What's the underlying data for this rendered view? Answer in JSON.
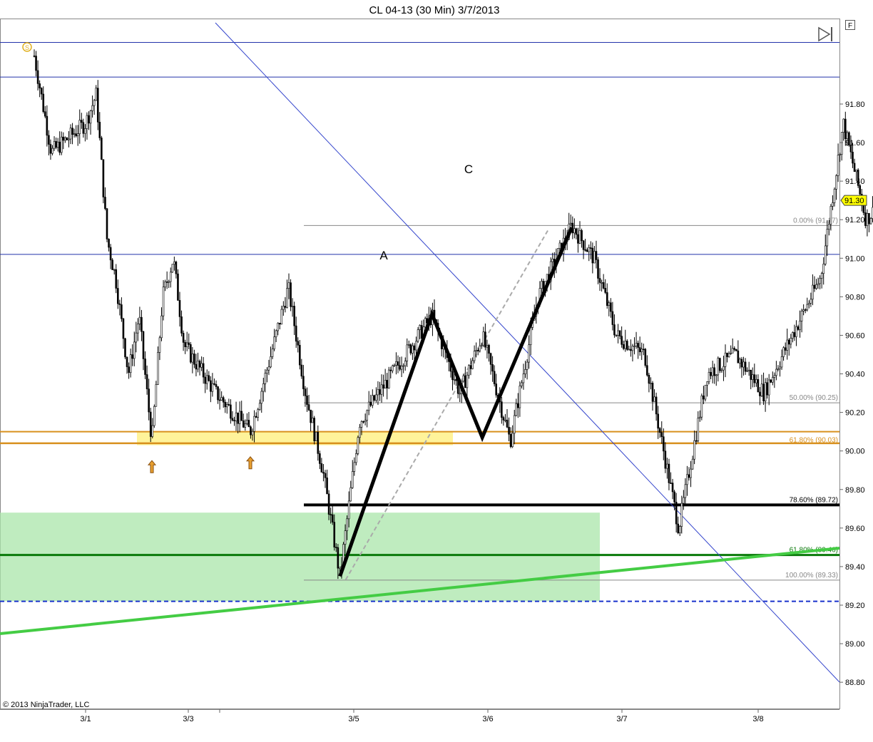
{
  "title": "CL 04-13 (30 Min)  3/7/2013",
  "copyright": "© 2013 NinjaTrader, LLC",
  "toolbar": {
    "f_label": "F"
  },
  "colors": {
    "background": "#ffffff",
    "bar": "#000000",
    "trendline": "#2233cc",
    "fib_grey": "#777777",
    "orange": "#d8901e",
    "yellow_zone": "#fff39a",
    "green_zone": "#9fe0a0",
    "green_line": "#44cc44",
    "dark_green": "#0a7a0a",
    "price_marker": "#ffff00"
  },
  "chart_data": {
    "type": "candlestick",
    "title": "CL 04-13 (30 Min)  3/7/2013",
    "instrument": "CL 04-13",
    "interval": "30 Min",
    "ylim": [
      88.66,
      92.24
    ],
    "y_ticks": [
      {
        "value": 88.8,
        "label": "88.80"
      },
      {
        "value": 89.0,
        "label": "89.00"
      },
      {
        "value": 89.2,
        "label": "89.20"
      },
      {
        "value": 89.4,
        "label": "89.40"
      },
      {
        "value": 89.6,
        "label": "89.60"
      },
      {
        "value": 89.8,
        "label": "89.80"
      },
      {
        "value": 90.0,
        "label": "90.00"
      },
      {
        "value": 90.2,
        "label": "90.20"
      },
      {
        "value": 90.4,
        "label": "90.40"
      },
      {
        "value": 90.6,
        "label": "90.60"
      },
      {
        "value": 90.8,
        "label": "90.80"
      },
      {
        "value": 91.0,
        "label": "91.00"
      },
      {
        "value": 91.2,
        "label": "91.20"
      },
      {
        "value": 91.4,
        "label": "91.40"
      },
      {
        "value": 91.6,
        "label": "91.60"
      },
      {
        "value": 91.8,
        "label": "91.80"
      }
    ],
    "x_ticks": [
      {
        "date": "2013-03-01",
        "label": "3/1"
      },
      {
        "date": "2013-03-03",
        "label": "3/3"
      },
      {
        "date": "2013-03-05",
        "label": "3/5"
      },
      {
        "date": "2013-03-06",
        "label": "3/6"
      },
      {
        "date": "2013-03-07",
        "label": "3/7"
      },
      {
        "date": "2013-03-08",
        "label": "3/8"
      }
    ],
    "last_price": {
      "value": 91.3,
      "label": "91.30"
    },
    "price_path": [
      [
        "2013-02-28 12:00",
        92.05
      ],
      [
        "2013-02-28 16:00",
        91.55
      ],
      [
        "2013-03-01 00:00",
        91.7
      ],
      [
        "2013-03-01 05:00",
        91.85
      ],
      [
        "2013-03-01 10:00",
        91.1
      ],
      [
        "2013-03-01 14:00",
        90.9
      ],
      [
        "2013-03-01 20:00",
        90.4
      ],
      [
        "2013-03-02 01:00",
        90.7
      ],
      [
        "2013-03-02 07:00",
        90.05
      ],
      [
        "2013-03-02 12:00",
        90.8
      ],
      [
        "2013-03-02 17:00",
        91.0
      ],
      [
        "2013-03-02 22:00",
        90.55
      ],
      [
        "2013-03-03 08:00",
        90.3
      ],
      [
        "2013-03-03 18:00",
        90.1
      ],
      [
        "2013-03-04 00:00",
        90.5
      ],
      [
        "2013-03-04 05:00",
        90.85
      ],
      [
        "2013-03-04 10:00",
        90.3
      ],
      [
        "2013-03-04 15:00",
        89.9
      ],
      [
        "2013-03-04 20:00",
        89.35
      ],
      [
        "2013-03-05 01:00",
        90.15
      ],
      [
        "2013-03-05 08:00",
        90.45
      ],
      [
        "2013-03-05 14:00",
        90.7
      ],
      [
        "2013-03-05 19:00",
        90.3
      ],
      [
        "2013-03-05 23:00",
        90.6
      ],
      [
        "2013-03-06 04:00",
        90.05
      ],
      [
        "2013-03-06 09:00",
        90.8
      ],
      [
        "2013-03-06 15:00",
        91.17
      ],
      [
        "2013-03-06 19:00",
        91.0
      ],
      [
        "2013-03-06 23:00",
        90.6
      ],
      [
        "2013-03-07 04:00",
        90.5
      ],
      [
        "2013-03-07 10:00",
        89.6
      ],
      [
        "2013-03-07 15:00",
        90.4
      ],
      [
        "2013-03-07 20:00",
        90.5
      ],
      [
        "2013-03-08 01:00",
        90.3
      ],
      [
        "2013-03-08 06:00",
        90.6
      ],
      [
        "2013-03-08 11:00",
        90.9
      ],
      [
        "2013-03-08 15:00",
        91.7
      ],
      [
        "2013-03-08 19:00",
        91.2
      ],
      [
        "2013-03-08 22:00",
        91.3
      ]
    ],
    "fibonacci_levels": [
      {
        "label": "0.00% (91.17)",
        "value": 91.17
      },
      {
        "label": "50.00% (90.25)",
        "value": 90.25
      },
      {
        "label": "61.80% (90.03)",
        "value": 90.03
      },
      {
        "label": "78.60% (89.72)",
        "value": 89.72
      },
      {
        "label": "61.80% (89.46)",
        "value": 89.46
      },
      {
        "label": "100.00% (89.33)",
        "value": 89.33
      }
    ],
    "horizontal_lines": [
      {
        "value": 92.12,
        "style": "blue"
      },
      {
        "value": 91.94,
        "style": "blue"
      },
      {
        "value": 91.02,
        "style": "blue"
      },
      {
        "value": 90.1,
        "style": "orange"
      },
      {
        "value": 90.04,
        "style": "orange"
      },
      {
        "value": 89.22,
        "style": "blue-dashed"
      }
    ],
    "zones": [
      {
        "name": "support zone",
        "color": "yellow",
        "from": 90.03,
        "to": 90.1
      },
      {
        "name": "demand zone",
        "color": "green",
        "from": 89.22,
        "to": 89.68
      }
    ],
    "pattern": {
      "type": "ABCD",
      "points": [
        {
          "label": "",
          "date": "2013-03-04 20:00",
          "value": 89.35
        },
        {
          "label": "A",
          "date": "2013-03-05 14:00",
          "value": 90.71
        },
        {
          "label": "",
          "date": "2013-03-05 23:00",
          "value": 90.07
        },
        {
          "label": "C",
          "date": "2013-03-06 15:00",
          "value": 91.16
        }
      ]
    },
    "markers": [
      {
        "type": "up-arrow",
        "date": "2013-03-02 07:00",
        "value": 89.95
      },
      {
        "type": "up-arrow",
        "date": "2013-03-03 18:00",
        "value": 89.97
      }
    ]
  }
}
